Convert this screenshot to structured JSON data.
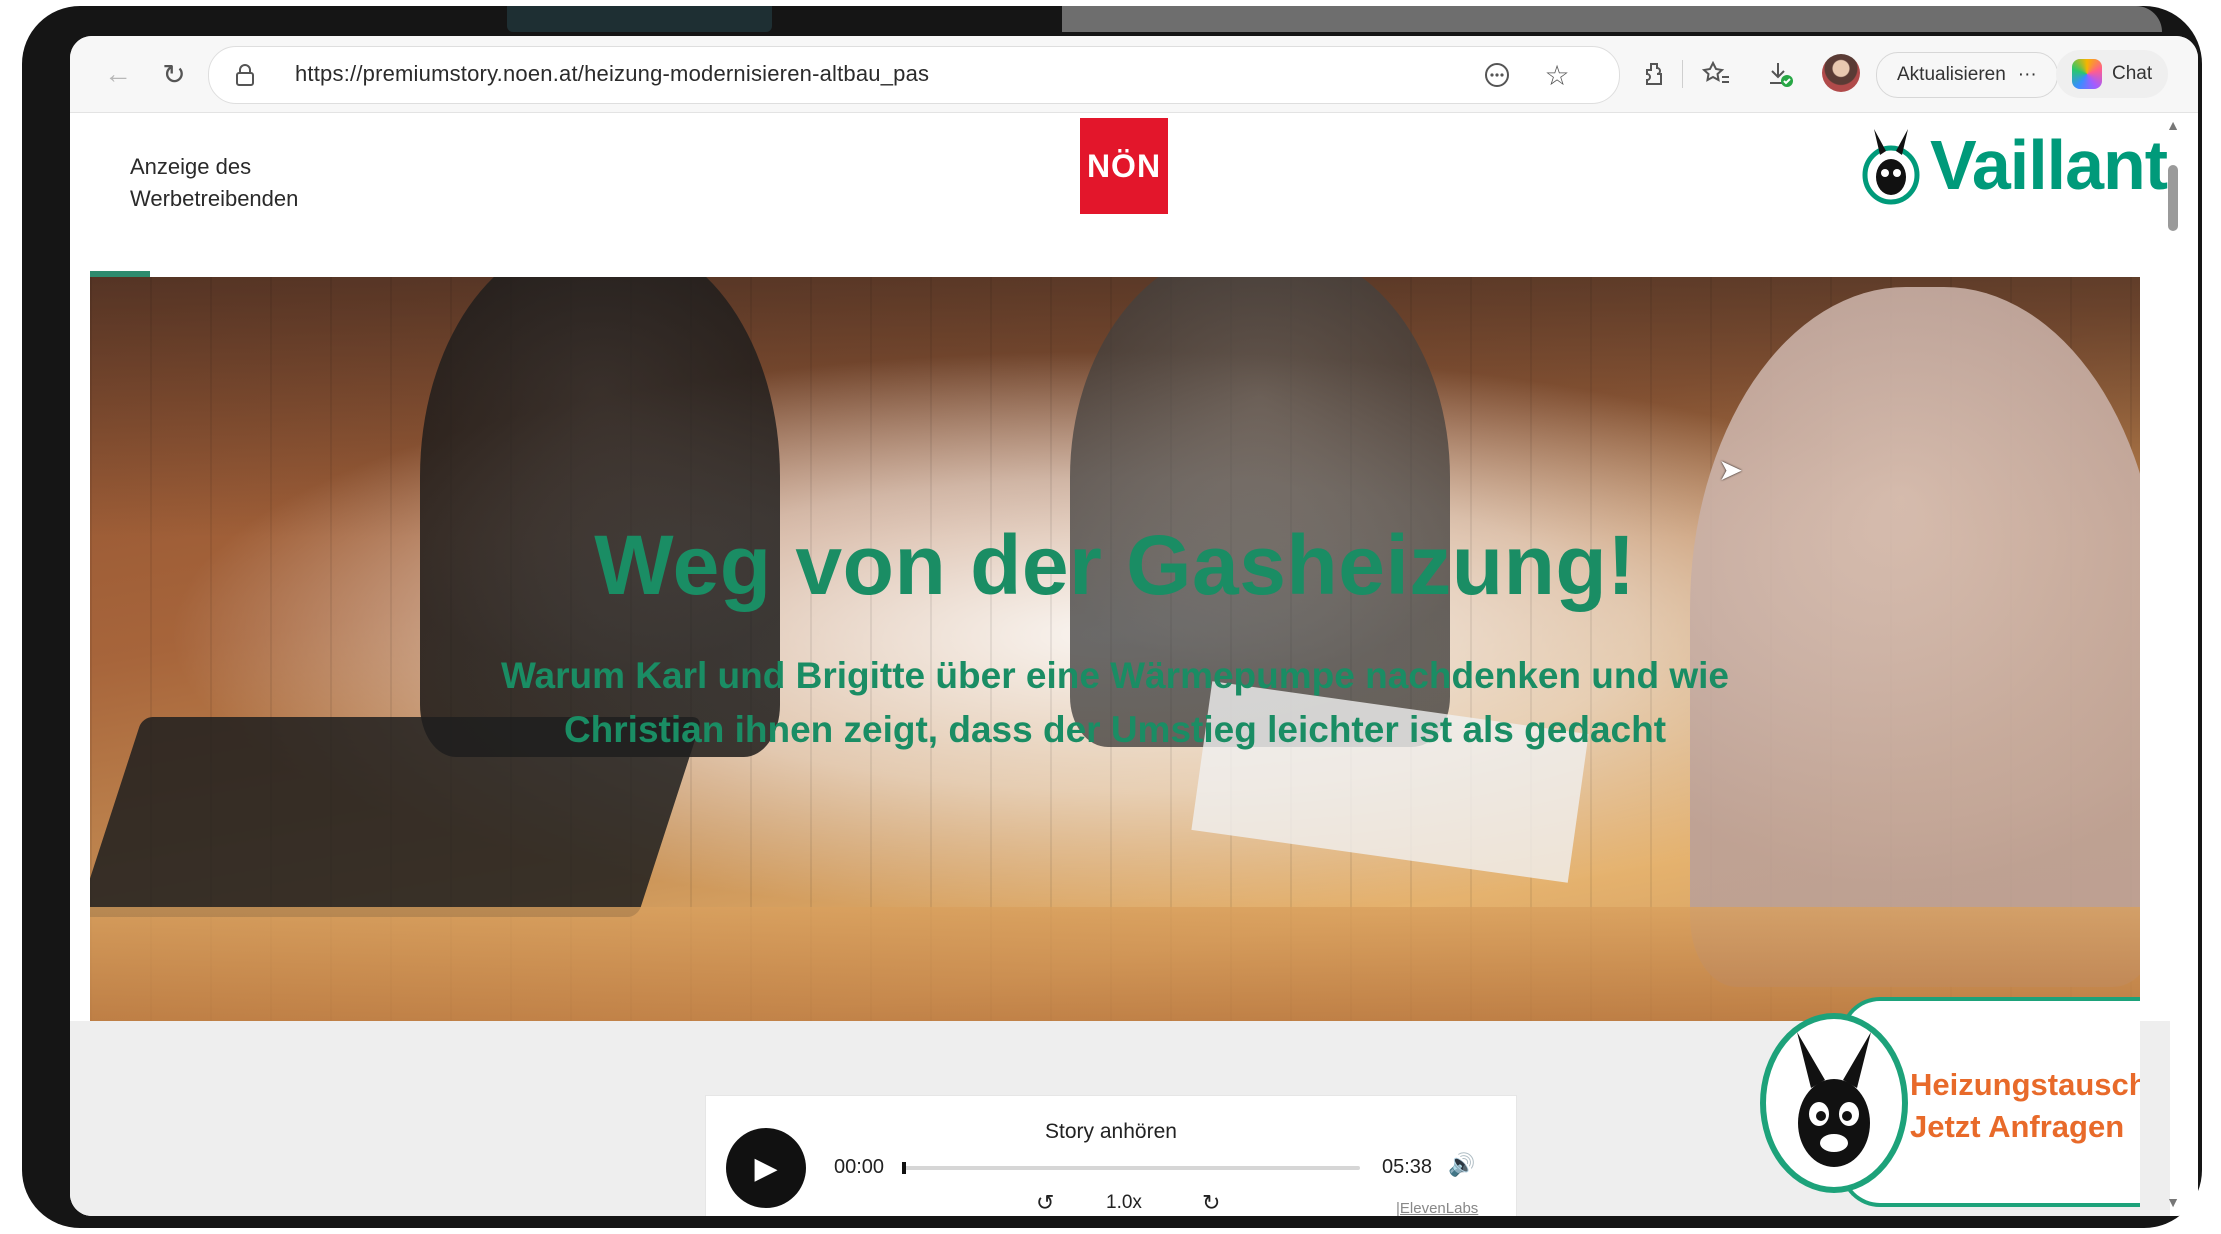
{
  "browser": {
    "url": "https://premiumstory.noen.at/heizung-modernisieren-altbau_pas",
    "update_label": "Aktualisieren",
    "more_label": "···",
    "chat_label": "Chat"
  },
  "header": {
    "ad_label": "Anzeige des Werbetreibenden",
    "non_logo": "NÖN",
    "vaillant_logo": "Vaillant"
  },
  "hero": {
    "title": "Weg von der Gasheizung!",
    "subtitle": "Warum Karl und Brigitte über eine Wärmepumpe nachdenken und wie Christian ihnen zeigt, dass der Umstieg leichter ist als gedacht"
  },
  "player": {
    "title": "Story anhören",
    "current_time": "00:00",
    "total_time": "05:38",
    "speed": "1.0x",
    "credit": "|ElevenLabs",
    "progress": 0
  },
  "cta": {
    "line1": "Heizungstausch",
    "line2": "Jetzt Anfragen"
  },
  "colors": {
    "accent_green": "#1a8d64",
    "brand_red": "#e3162b",
    "cta_orange": "#e86a2a"
  }
}
